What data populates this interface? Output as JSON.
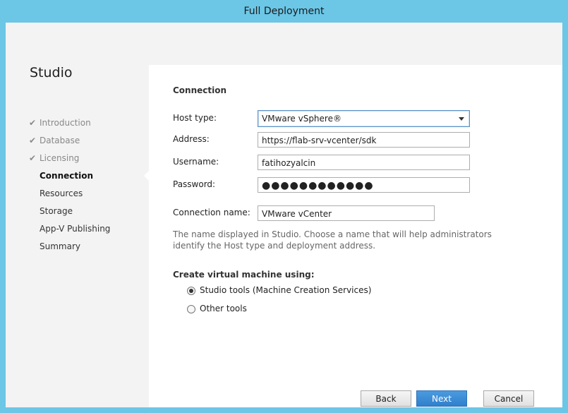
{
  "window": {
    "title": "Full Deployment"
  },
  "sidebar": {
    "title": "Studio",
    "steps": [
      {
        "label": "Introduction",
        "state": "done"
      },
      {
        "label": "Database",
        "state": "done"
      },
      {
        "label": "Licensing",
        "state": "done"
      },
      {
        "label": "Connection",
        "state": "current"
      },
      {
        "label": "Resources",
        "state": "pending"
      },
      {
        "label": "Storage",
        "state": "pending"
      },
      {
        "label": "App-V Publishing",
        "state": "pending"
      },
      {
        "label": "Summary",
        "state": "pending"
      }
    ]
  },
  "main": {
    "section_title": "Connection",
    "host_type": {
      "label": "Host type:",
      "value": "VMware vSphere®"
    },
    "address": {
      "label": "Address:",
      "value": "https://flab-srv-vcenter/sdk"
    },
    "username": {
      "label": "Username:",
      "value": "fatihozyalcin"
    },
    "password": {
      "label": "Password:",
      "value": "●●●●●●●●●●●●"
    },
    "connection_name": {
      "label": "Connection name:",
      "value": "VMware vCenter"
    },
    "help_text": "The name displayed in Studio. Choose a name that will help administrators identify the Host type and deployment address.",
    "create_vm_title": "Create virtual machine using:",
    "radio_options": [
      {
        "label": "Studio tools (Machine Creation Services)",
        "checked": true
      },
      {
        "label": "Other tools",
        "checked": false
      }
    ]
  },
  "buttons": {
    "back": "Back",
    "next": "Next",
    "cancel": "Cancel"
  }
}
